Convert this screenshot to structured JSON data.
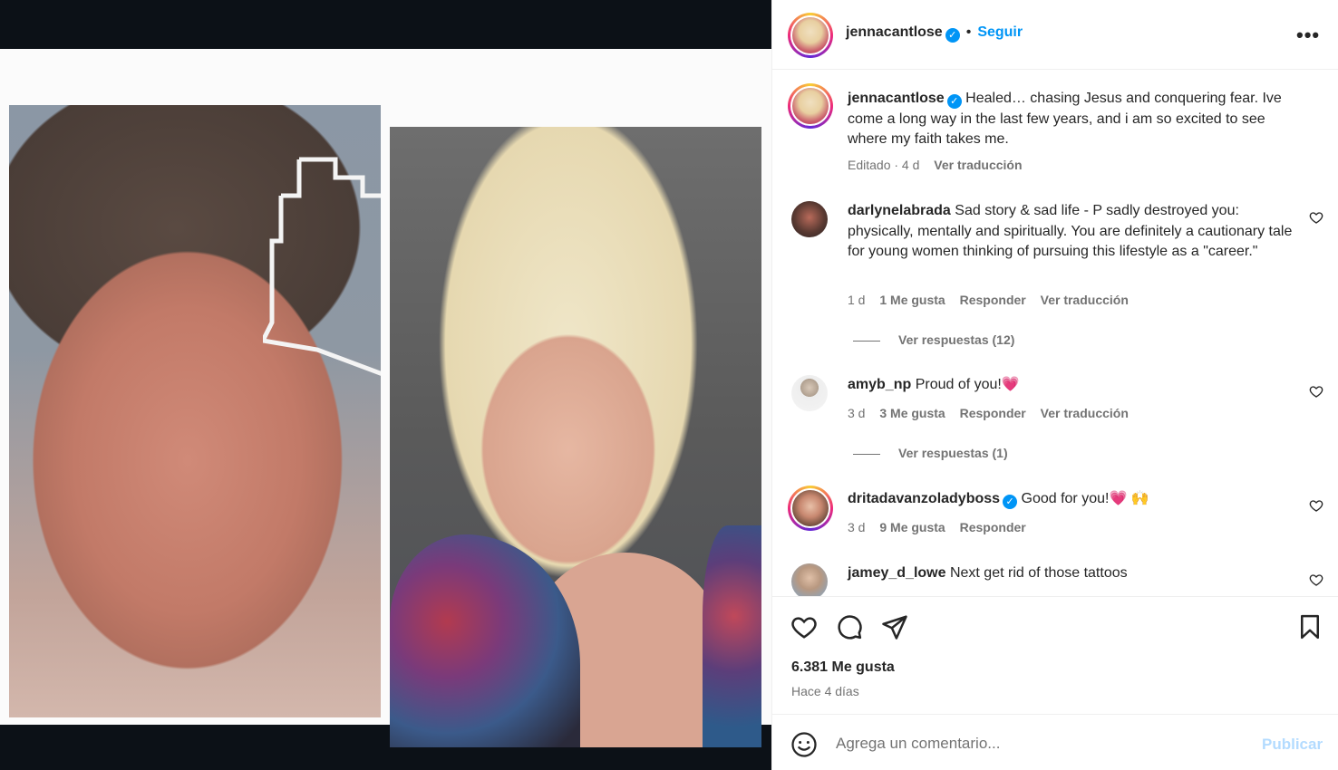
{
  "post": {
    "author": "jennacantlose",
    "separator": "•",
    "follow_label": "Seguir",
    "more_label": "•••"
  },
  "caption": {
    "username": "jennacantlose",
    "text": "Healed… chasing Jesus and conquering fear. Ive come a long way in the last few years, and i am so excited to see where my faith takes me.",
    "edited": "Editado · 4 d",
    "translate": "Ver traducción"
  },
  "comments": [
    {
      "username": "darlynelabrada",
      "text": "Sad story & sad life - P sadly destroyed you: physically, mentally and spiritually. You are definitely a cautionary tale for young women thinking of pursuing this lifestyle as a \"career.\"",
      "time": "1 d",
      "likes": "1 Me gusta",
      "reply": "Responder",
      "translate": "Ver traducción",
      "replies": "Ver respuestas (12)"
    },
    {
      "username": "amyb_np",
      "text": "Proud of you!💗",
      "time": "3 d",
      "likes": "3 Me gusta",
      "reply": "Responder",
      "translate": "Ver traducción",
      "replies": "Ver respuestas (1)"
    },
    {
      "username": "dritadavanzoladyboss",
      "text": "Good for you!💗 🙌",
      "time": "3 d",
      "likes": "9 Me gusta",
      "reply": "Responder"
    },
    {
      "username": "jamey_d_lowe",
      "text": "Next get rid of those tattoos"
    }
  ],
  "stats": {
    "likes": "6.381 Me gusta",
    "time_ago": "Hace 4 días"
  },
  "composer": {
    "placeholder": "Agrega un comentario...",
    "publish_label": "Publicar"
  },
  "icons": {
    "like": "heart-icon",
    "comment": "comment-icon",
    "share": "paper-plane-icon",
    "save": "bookmark-icon",
    "emoji": "emoji-icon",
    "verified": "verified-badge-icon"
  },
  "colors": {
    "accent": "#0095f6",
    "muted": "#737373",
    "publish_disabled": "#b3dbff"
  }
}
